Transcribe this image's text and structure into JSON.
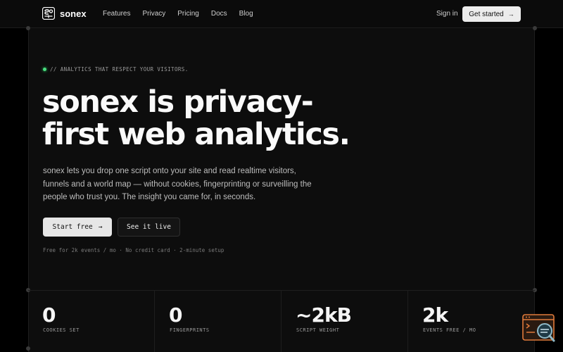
{
  "brand": {
    "name": "sonex",
    "logo_icon": "sonex-logo-icon"
  },
  "nav": {
    "links": [
      "Features",
      "Privacy",
      "Pricing",
      "Docs",
      "Blog"
    ],
    "sign_in": "Sign in",
    "cta": "Get started",
    "cta_icon": "arrow-right-icon"
  },
  "hero": {
    "eyebrow": "// ANALYTICS THAT RESPECT YOUR VISITORS.",
    "headline_line1": "sonex is privacy-",
    "headline_line2": "first web analytics.",
    "lead": "sonex lets you drop one script onto your site and read realtime visitors, funnels and a world map — without cookies, fingerprinting or surveilling the people who trust you. The insight you came for, in seconds.",
    "primary_button": "Start free",
    "secondary_button": "See it live",
    "fineprint": "Free for 2k events / mo · No credit card · 2-minute setup"
  },
  "stats": [
    {
      "value": "0",
      "label": "COOKIES SET"
    },
    {
      "value": "0",
      "label": "FINGERPRINTS"
    },
    {
      "value": "~2kB",
      "label": "SCRIPT WEIGHT"
    },
    {
      "value": "2k",
      "label": "EVENTS FREE / MO"
    }
  ],
  "colors": {
    "background": "#0a0a0a",
    "accent_dot": "#4ade80",
    "button_light": "#e6e6e6",
    "widget_orange": "#e07a3a"
  },
  "widget": {
    "icon": "terminal-search-icon"
  }
}
